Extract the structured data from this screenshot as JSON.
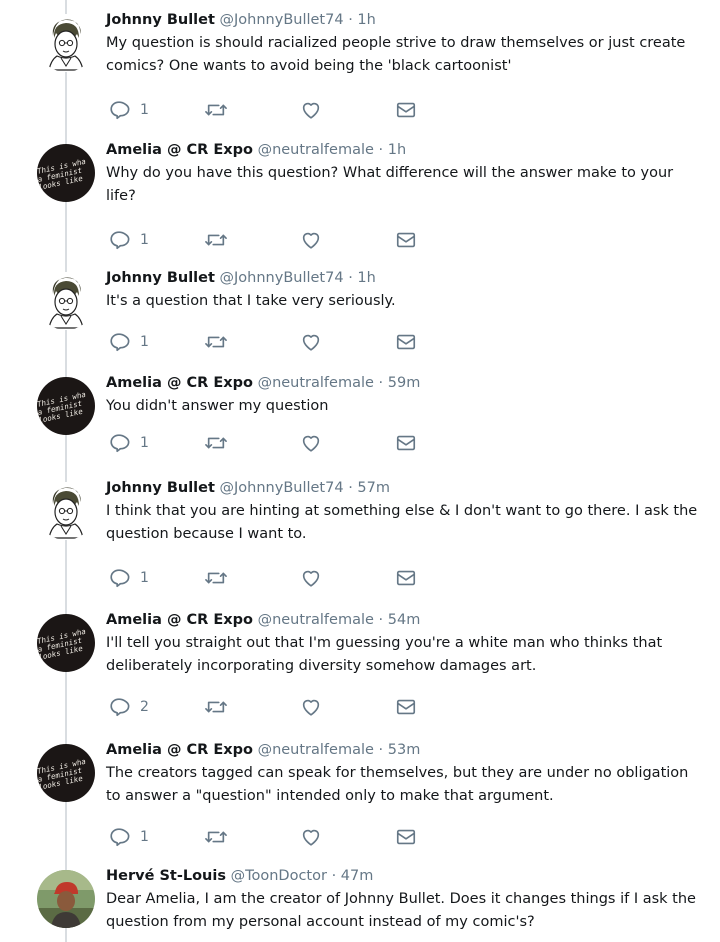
{
  "tweets": [
    {
      "avatar": "johnny-bullet-avatar",
      "name": "Johnny Bullet",
      "handle": "@JohnnyBullet74",
      "time": "· 1h",
      "text": "My question is should racialized people strive to draw themselves or just create comics? One wants to avoid being the 'black cartoonist'",
      "reply_count": "1"
    },
    {
      "avatar": "feminist-avatar",
      "name": "Amelia @ CR Expo",
      "handle": "@neutralfemale",
      "time": "· 1h",
      "text": "Why do you have this question? What difference will the answer make to your life?",
      "reply_count": "1"
    },
    {
      "avatar": "johnny-bullet-avatar",
      "name": "Johnny Bullet",
      "handle": "@JohnnyBullet74",
      "time": "· 1h",
      "text": "It's a question that I take very seriously.",
      "reply_count": "1"
    },
    {
      "avatar": "feminist-avatar",
      "name": "Amelia @ CR Expo",
      "handle": "@neutralfemale",
      "time": "· 59m",
      "text": "You didn't answer my question",
      "reply_count": "1"
    },
    {
      "avatar": "johnny-bullet-avatar",
      "name": "Johnny Bullet",
      "handle": "@JohnnyBullet74",
      "time": "· 57m",
      "text": "I think that you are hinting at something else & I don't want to go there. I ask the question because I want to.",
      "reply_count": "1"
    },
    {
      "avatar": "feminist-avatar",
      "name": "Amelia @ CR Expo",
      "handle": "@neutralfemale",
      "time": "· 54m",
      "text": "I'll tell you straight out that I'm guessing you're a white man who thinks that deliberately incorporating diversity somehow damages art.",
      "reply_count": "2"
    },
    {
      "avatar": "feminist-avatar",
      "name": "Amelia @ CR Expo",
      "handle": "@neutralfemale",
      "time": "· 53m",
      "text": "The creators tagged can speak for themselves, but they are under no obligation to answer a \"question\" intended only to make that argument.",
      "reply_count": "1"
    },
    {
      "avatar": "toondoctor-avatar",
      "name": "Hervé St-Louis",
      "handle": "@ToonDoctor",
      "time": "· 47m",
      "text": "Dear Amelia, I am the creator of Johnny Bullet. Does it changes things if I ask the question from my personal account instead of my comic's?",
      "reply_count": ""
    }
  ],
  "avatar_text": {
    "feminist": [
      "This is wha",
      "a feminist",
      "looks like"
    ]
  },
  "colors": {
    "text": "#14171a",
    "meta": "#657786",
    "thread_line": "#d9dde1"
  }
}
